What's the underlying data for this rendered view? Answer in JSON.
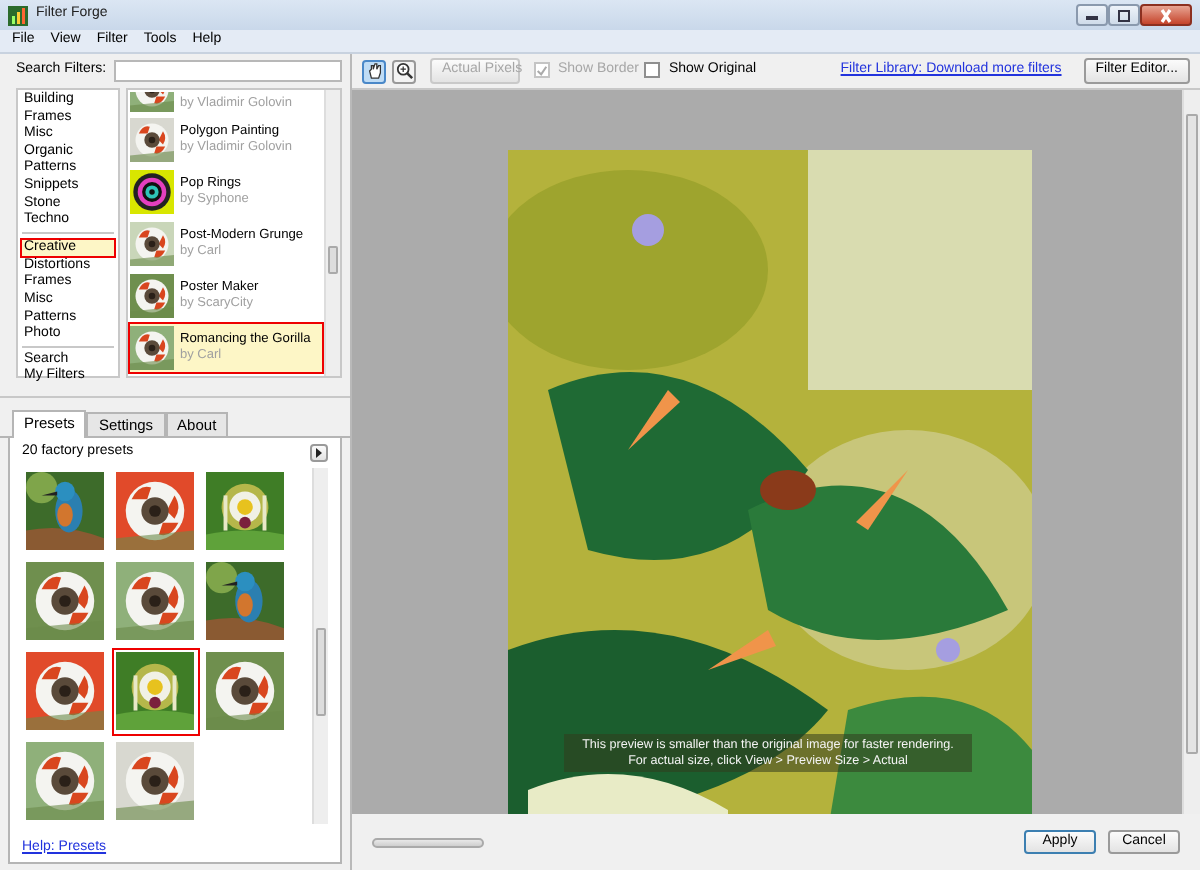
{
  "window": {
    "title": "Filter Forge"
  },
  "menu": [
    "File",
    "View",
    "Filter",
    "Tools",
    "Help"
  ],
  "search": {
    "label": "Search Filters:"
  },
  "categories": [
    {
      "items": [
        {
          "label": "Building",
          "selected": false
        },
        {
          "label": "Frames",
          "selected": false
        },
        {
          "label": "Misc",
          "selected": false
        },
        {
          "label": "Organic",
          "selected": false
        },
        {
          "label": "Patterns",
          "selected": false
        },
        {
          "label": "Snippets",
          "selected": false
        },
        {
          "label": "Stone",
          "selected": false
        },
        {
          "label": "Techno",
          "selected": false
        }
      ]
    },
    {
      "items": [
        {
          "label": "Creative",
          "selected": true
        },
        {
          "label": "Distortions",
          "selected": false
        },
        {
          "label": "Frames",
          "selected": false
        },
        {
          "label": "Misc",
          "selected": false
        },
        {
          "label": "Patterns",
          "selected": false
        },
        {
          "label": "Photo",
          "selected": false
        }
      ]
    },
    {
      "items": [
        {
          "label": "Search",
          "selected": false
        },
        {
          "label": "My Filters",
          "selected": false
        }
      ]
    }
  ],
  "filters": [
    {
      "author": "by Vladimir Golovin",
      "selected": false
    },
    {
      "name": "Polygon Painting",
      "author": "by Vladimir Golovin",
      "selected": false
    },
    {
      "name": "Pop Rings",
      "author": "by Syphone",
      "selected": false
    },
    {
      "name": "Post-Modern Grunge",
      "author": "by Carl",
      "selected": false
    },
    {
      "name": "Poster Maker",
      "author": "by ScaryCity",
      "selected": false
    },
    {
      "name": "Romancing the Gorilla",
      "author": "by Carl",
      "selected": true
    }
  ],
  "tabs": [
    {
      "label": "Presets",
      "selected": true
    },
    {
      "label": "Settings",
      "selected": false
    },
    {
      "label": "About",
      "selected": false
    }
  ],
  "presets": {
    "count": "20 factory presets",
    "items": [
      {
        "selected": false
      },
      {
        "selected": false
      },
      {
        "selected": false
      },
      {
        "selected": false
      },
      {
        "selected": false
      },
      {
        "selected": false
      },
      {
        "selected": false
      },
      {
        "selected": true
      },
      {
        "selected": false
      },
      {
        "selected": false
      },
      {
        "selected": false
      }
    ]
  },
  "help_link": "Help: Presets",
  "toolbar": {
    "tools": [
      {
        "kind": "hand",
        "selected": true
      },
      {
        "kind": "zoom",
        "selected": false
      }
    ],
    "actual_pixels": {
      "label": "Actual Pixels",
      "disabled": true
    },
    "show_border": {
      "label": "Show Border",
      "checked": true,
      "disabled": true
    },
    "show_original": {
      "label": "Show Original",
      "checked": false,
      "disabled": false
    },
    "library_link": "Filter Library: Download more filters",
    "editor_button": "Filter Editor..."
  },
  "preview": {
    "notice": [
      "This preview is smaller than the original image for faster rendering.",
      "For actual size, click View > Preview Size > Actual"
    ]
  },
  "buttons": [
    {
      "label": "Apply",
      "default": true
    },
    {
      "label": "Cancel",
      "default": false
    }
  ]
}
